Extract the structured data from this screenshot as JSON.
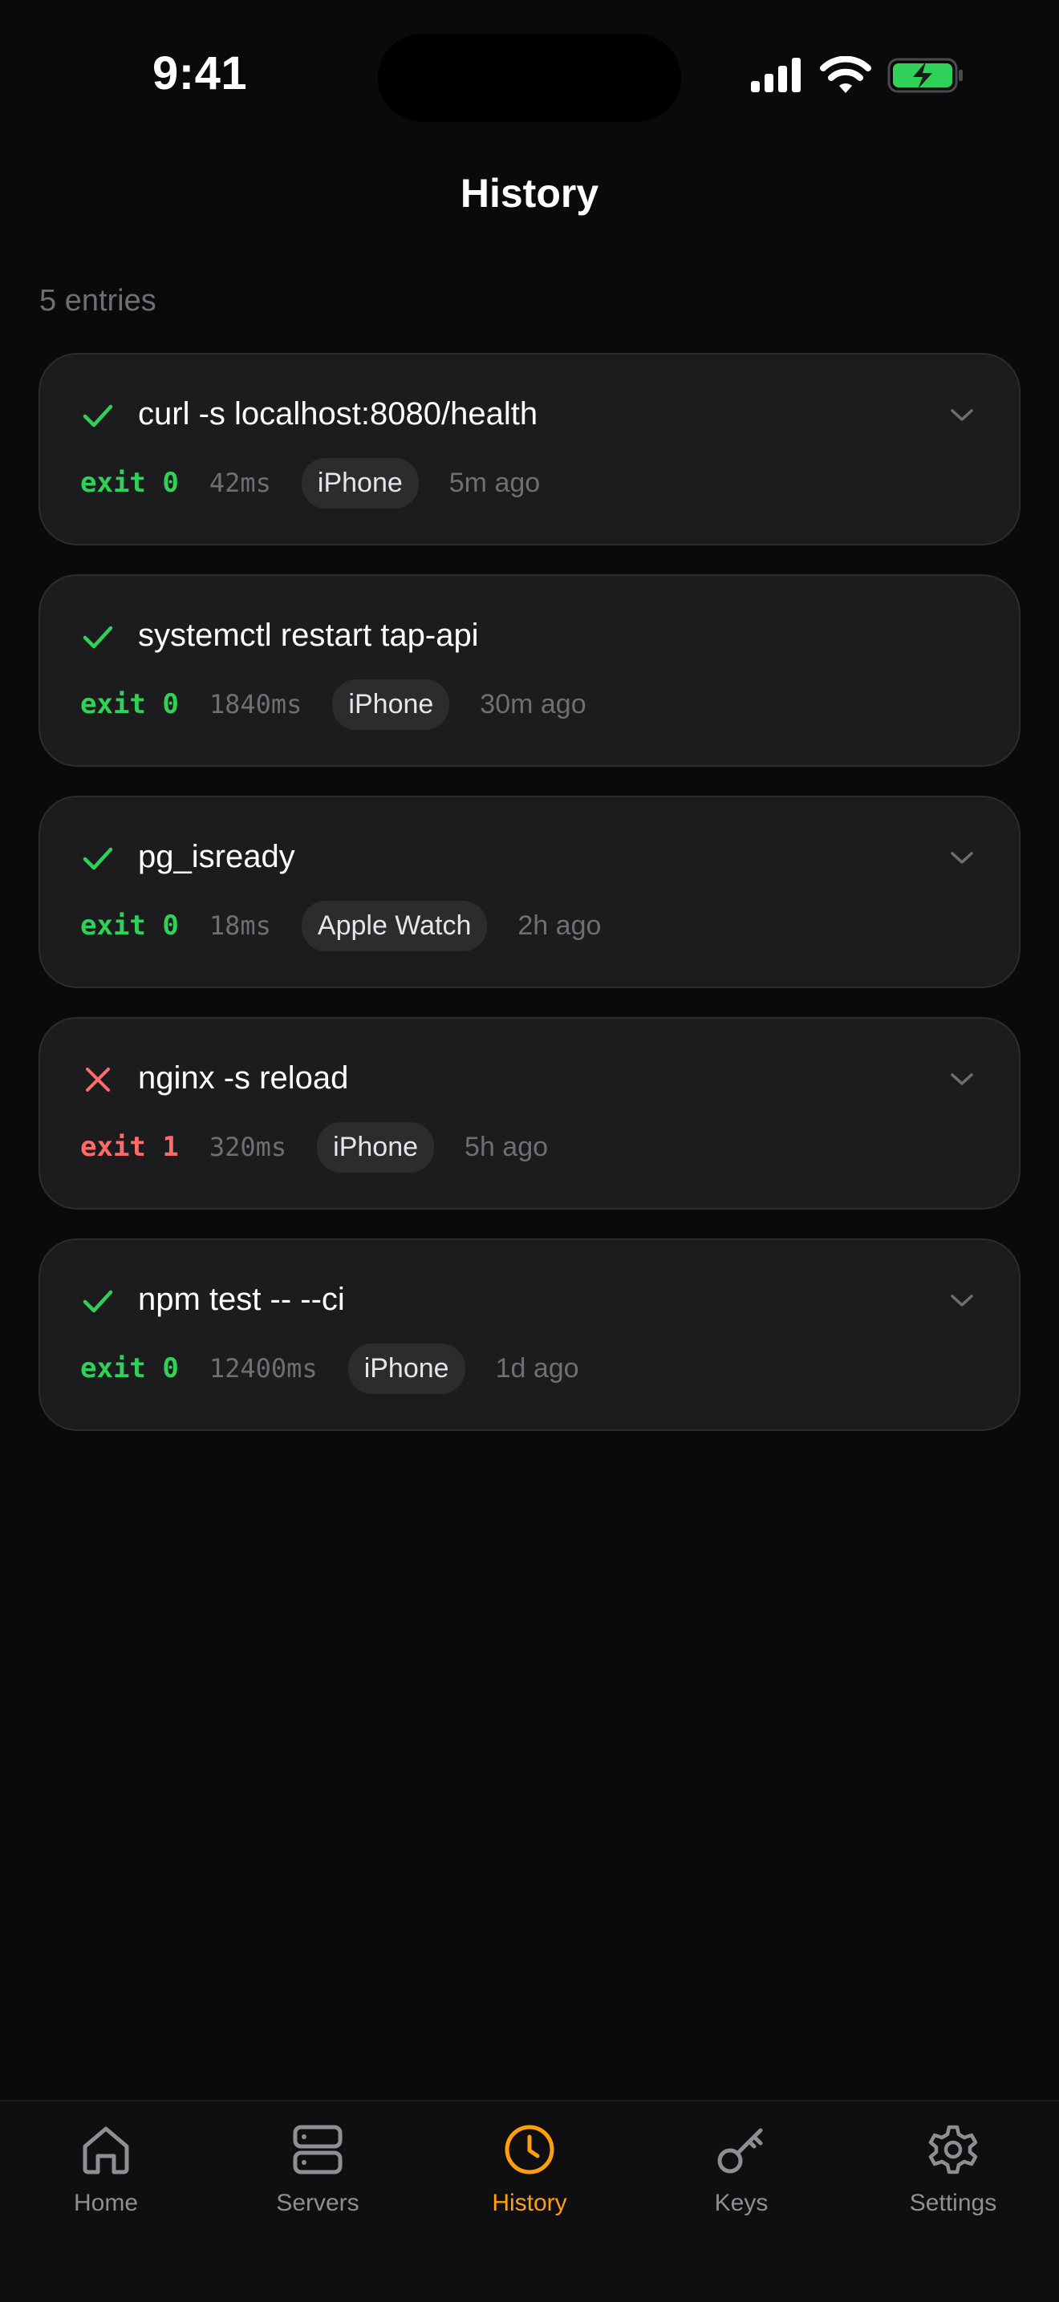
{
  "status_bar": {
    "time": "9:41",
    "icons": [
      "cellular-signal-icon",
      "wifi-icon",
      "battery-charging-icon"
    ]
  },
  "header": {
    "title": "History",
    "entries_count": "5 entries"
  },
  "entries": [
    {
      "status": "success",
      "command": "curl -s localhost:8080/health",
      "exit": "exit 0",
      "duration": "42ms",
      "device": "iPhone",
      "time_ago": "5m ago",
      "expandable": true
    },
    {
      "status": "success",
      "command": "systemctl restart tap-api",
      "exit": "exit 0",
      "duration": "1840ms",
      "device": "iPhone",
      "time_ago": "30m ago",
      "expandable": false
    },
    {
      "status": "success",
      "command": "pg_isready",
      "exit": "exit 0",
      "duration": "18ms",
      "device": "Apple Watch",
      "time_ago": "2h ago",
      "expandable": true
    },
    {
      "status": "failure",
      "command": "nginx -s reload",
      "exit": "exit 1",
      "duration": "320ms",
      "device": "iPhone",
      "time_ago": "5h ago",
      "expandable": true
    },
    {
      "status": "success",
      "command": "npm test -- --ci",
      "exit": "exit 0",
      "duration": "12400ms",
      "device": "iPhone",
      "time_ago": "1d ago",
      "expandable": true
    }
  ],
  "tab_bar": {
    "items": [
      {
        "label": "Home",
        "icon": "house-icon",
        "active": false
      },
      {
        "label": "Servers",
        "icon": "server-icon",
        "active": false
      },
      {
        "label": "History",
        "icon": "clock-icon",
        "active": true
      },
      {
        "label": "Keys",
        "icon": "key-icon",
        "active": false
      },
      {
        "label": "Settings",
        "icon": "gear-icon",
        "active": false
      }
    ]
  },
  "colors": {
    "background": "#0a0a0c",
    "card": "#1c1c1e",
    "success": "#30d158",
    "failure": "#ff6b6b",
    "accent": "#ff9f0a",
    "muted": "#6e6e73"
  }
}
